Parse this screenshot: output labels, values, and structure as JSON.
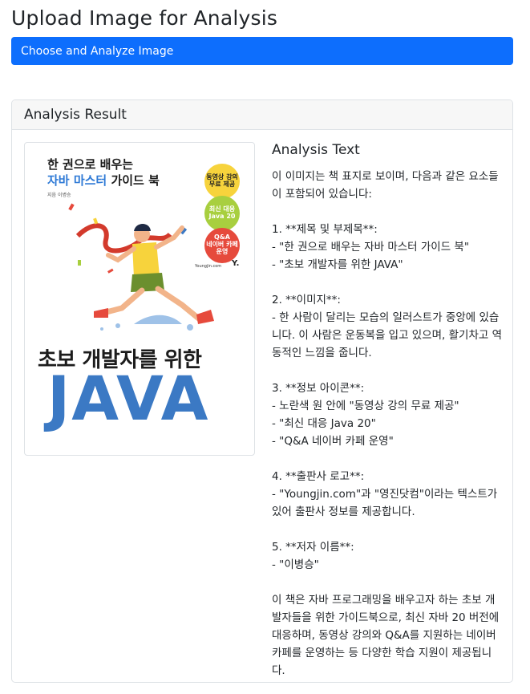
{
  "page": {
    "title": "Upload Image for Analysis"
  },
  "upload": {
    "button_label": "Choose and Analyze Image"
  },
  "result": {
    "header": "Analysis Result",
    "text_heading": "Analysis Text",
    "text_body": "이 이미지는 책 표지로 보이며, 다음과 같은 요소들이 포함되어 있습니다:\n\n1. **제목 및 부제목**:\n- \"한 권으로 배우는 자바 마스터 가이드 북\"\n- \"초보 개발자를 위한 JAVA\"\n\n2. **이미지**:\n- 한 사람이 달리는 모습의 일러스트가 중앙에 있습니다. 이 사람은 운동복을 입고 있으며, 활기차고 역동적인 느낌을 줍니다.\n\n3. **정보 아이콘**:\n- 노란색 원 안에 \"동영상 강의 무료 제공\"\n- \"최신 대응 Java 20\"\n- \"Q&A 네이버 카페 운영\"\n\n4. **출판사 로고**:\n- \"Youngjin.com\"과 \"영진닷컴\"이라는 텍스트가 있어 출판사 정보를 제공합니다.\n\n5. **저자 이름**:\n- \"이병승\"\n\n이 책은 자바 프로그래밍을 배우고자 하는 초보 개발자들을 위한 가이드북으로, 최신 자바 20 버전에 대응하며, 동영상 강의와 Q&A를 지원하는 네이버 카페를 운영하는 등 다양한 학습 지원이 제공됩니다."
  },
  "cover": {
    "line1": "한 권으로 배우는",
    "line2_blue": "자바 마스터",
    "line2_rest": " 가이드 북",
    "author": "지음 이병승",
    "badge1": "동영상 강의\n무료 제공",
    "badge2": "최신 대응\nJava 20",
    "badge3": "Q&A\n네이버 카페\n운영",
    "publisher": "Youngjin.com",
    "publisher_mark": "Y.",
    "big_title_1": "초보 개발자를 위한",
    "big_title_2": "JAVA",
    "colors": {
      "java_blue": "#3b79c4",
      "accent_red": "#e64a3c",
      "yellow": "#f7d33c",
      "green": "#a8cf3f"
    }
  },
  "colors": {
    "primary_button": "#0d6efd",
    "card_header_bg": "#f7f7f7",
    "border": "#dee2e6"
  }
}
